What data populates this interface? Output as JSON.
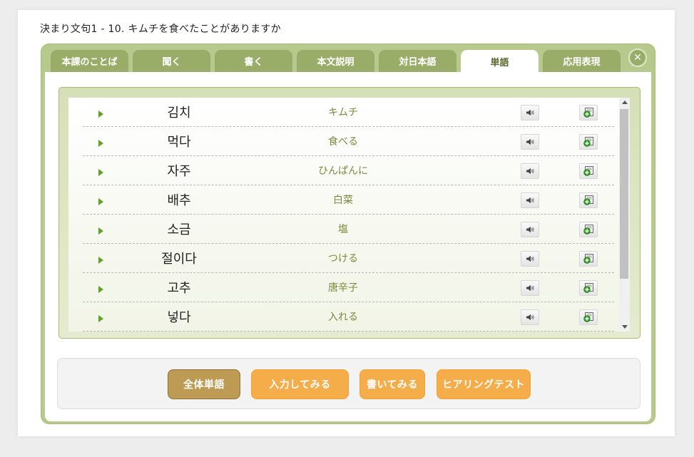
{
  "page": {
    "title": "決まり文句1 - 10. キムチを食べたことがありますか"
  },
  "tabs": [
    {
      "label": "本課のことば"
    },
    {
      "label": "聞く"
    },
    {
      "label": "書く"
    },
    {
      "label": "本文説明"
    },
    {
      "label": "対日本語"
    },
    {
      "label": "単語",
      "active": true
    },
    {
      "label": "応用表現"
    }
  ],
  "close_glyph": "✕",
  "words": [
    {
      "korean": "김치",
      "japanese": "キムチ"
    },
    {
      "korean": "먹다",
      "japanese": "食べる"
    },
    {
      "korean": "자주",
      "japanese": "ひんぱんに"
    },
    {
      "korean": "배추",
      "japanese": "白菜"
    },
    {
      "korean": "소금",
      "japanese": "塩"
    },
    {
      "korean": "절이다",
      "japanese": "つける"
    },
    {
      "korean": "고추",
      "japanese": "唐辛子"
    },
    {
      "korean": "넣다",
      "japanese": "入れる"
    }
  ],
  "actions": {
    "all_words": "全体単語",
    "input_practice": "入力してみる",
    "writing_practice": "書いてみる",
    "hearing_test": "ヒアリングテスト"
  },
  "colors": {
    "panel_green": "#b8c98e",
    "tab_green": "#9aad68",
    "play_green": "#5fa224",
    "japanese_text": "#7b8a3a",
    "orange_button": "#f5ad4a",
    "primary_button": "#bd9b55"
  },
  "icons": {
    "play": "play-icon",
    "sound": "speaker-icon",
    "add": "add-to-list-icon",
    "close": "close-icon"
  }
}
